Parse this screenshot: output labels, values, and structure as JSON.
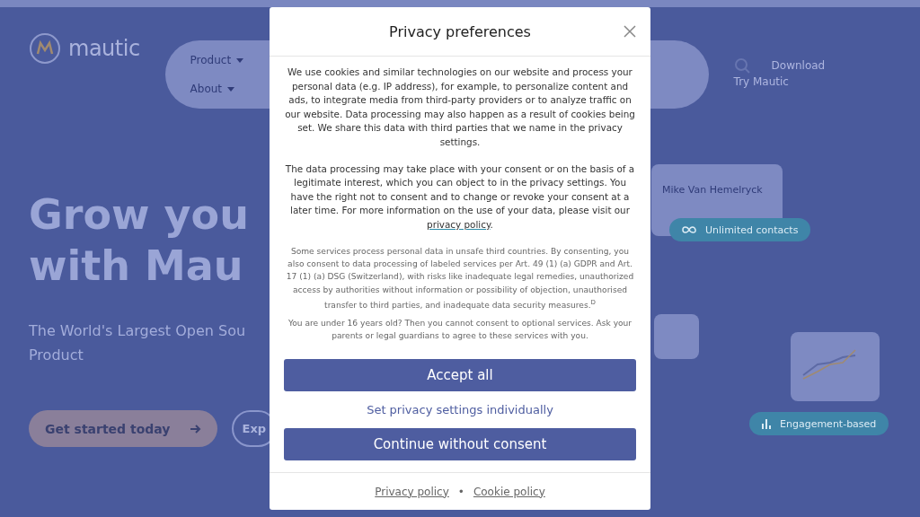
{
  "page": {
    "logo": "mautic",
    "nav": [
      {
        "label": "Product"
      },
      {
        "label": "About"
      }
    ],
    "download": "Download",
    "try": "Try Mautic",
    "hero_title": [
      "Grow you",
      "with Mau"
    ],
    "hero_subtitle": [
      "The World's Largest Open Sou",
      "Product"
    ],
    "cta_primary": "Get started today",
    "cta_secondary": "Exp",
    "cards": {
      "contact_name": "Mike Van Hemelryck",
      "contacts_tag": "Unlimited contacts",
      "engagement_tag": "Engagement-based"
    }
  },
  "dialog": {
    "title": "Privacy preferences",
    "paragraphs": [
      {
        "text": "We use cookies and similar technologies on our website and process your personal data (e.g. IP address), for example, to personalize content and ads, to integrate media from third-party providers or to analyze traffic on our website. Data processing may also happen as a result of cookies being set. We share this data with third parties that we name in the privacy settings."
      },
      {
        "text": "The data processing may take place with your consent or on the basis of a legitimate interest, which you can object to in the privacy settings. You have the right not to consent and to change or revoke your consent at a later time. For more information on the use of your data, please visit our ",
        "link": "privacy policy",
        "after": "."
      }
    ],
    "notes": [
      "Some services process personal data in unsafe third countries. By consenting, you also consent to data processing of labeled services per Art. 49 (1) (a) GDPR and Art. 17 (1) (a) DSG (Switzerland), with risks like inadequate legal remedies, unauthorized access by authorities without information or possibility of objection, unauthorised transfer to third parties, and inadequate data security measures.$^{D}$",
      "You are under 16 years old? Then you cannot consent to optional services. Ask your parents or legal guardians to agree to these services with you."
    ],
    "accept": "Accept all",
    "individual": "Set privacy settings individually",
    "reject": "Continue without consent",
    "footer_links": [
      "Privacy policy",
      "Cookie policy"
    ],
    "footer_separator": "•"
  }
}
